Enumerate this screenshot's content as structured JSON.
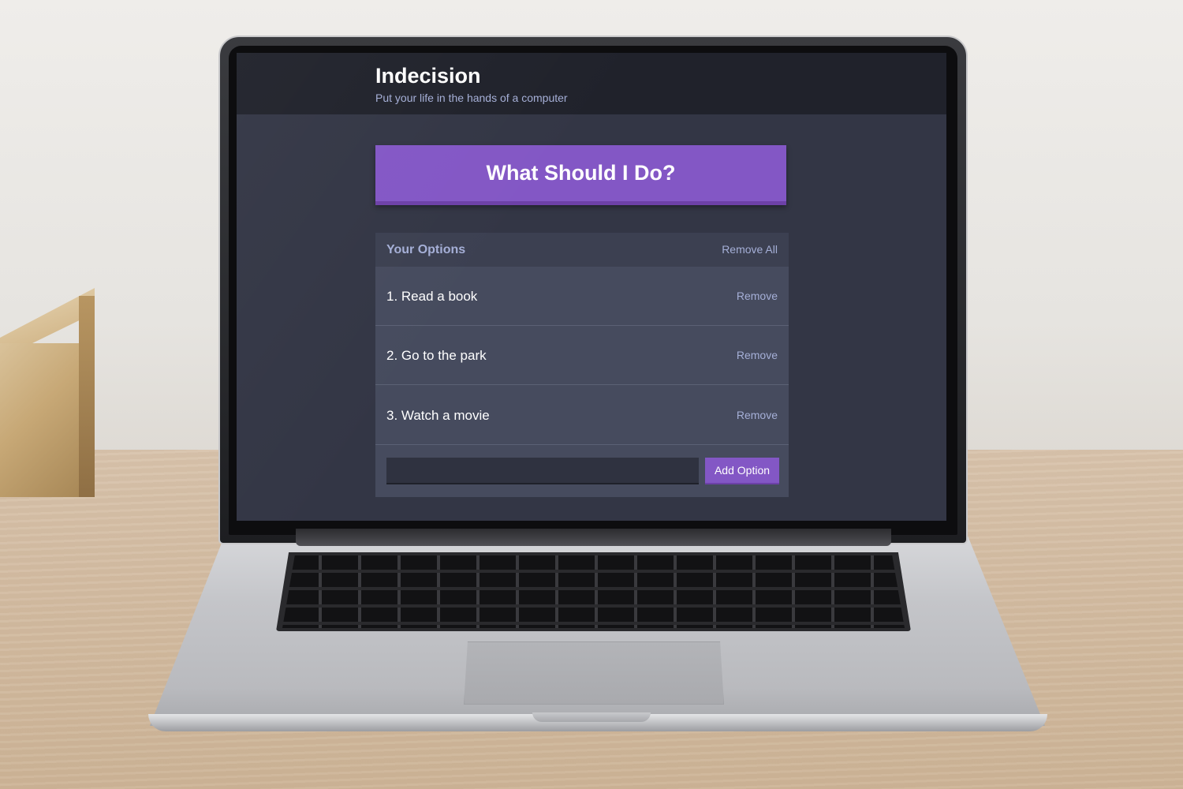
{
  "app": {
    "title": "Indecision",
    "subtitle": "Put your life in the hands of a computer"
  },
  "main": {
    "pick_button_label": "What Should I Do?"
  },
  "options": {
    "header_title": "Your Options",
    "remove_all_label": "Remove All",
    "items": [
      {
        "label": "1. Read a book",
        "remove_label": "Remove"
      },
      {
        "label": "2. Go to the park",
        "remove_label": "Remove"
      },
      {
        "label": "3. Watch a movie",
        "remove_label": "Remove"
      }
    ]
  },
  "add_form": {
    "input_value": "",
    "button_label": "Add Option"
  },
  "colors": {
    "accent": "#8357c5",
    "header_bg": "#20222b",
    "page_bg": "#333645",
    "panel_bg": "#464b5e",
    "muted_text": "#a5afd7"
  }
}
